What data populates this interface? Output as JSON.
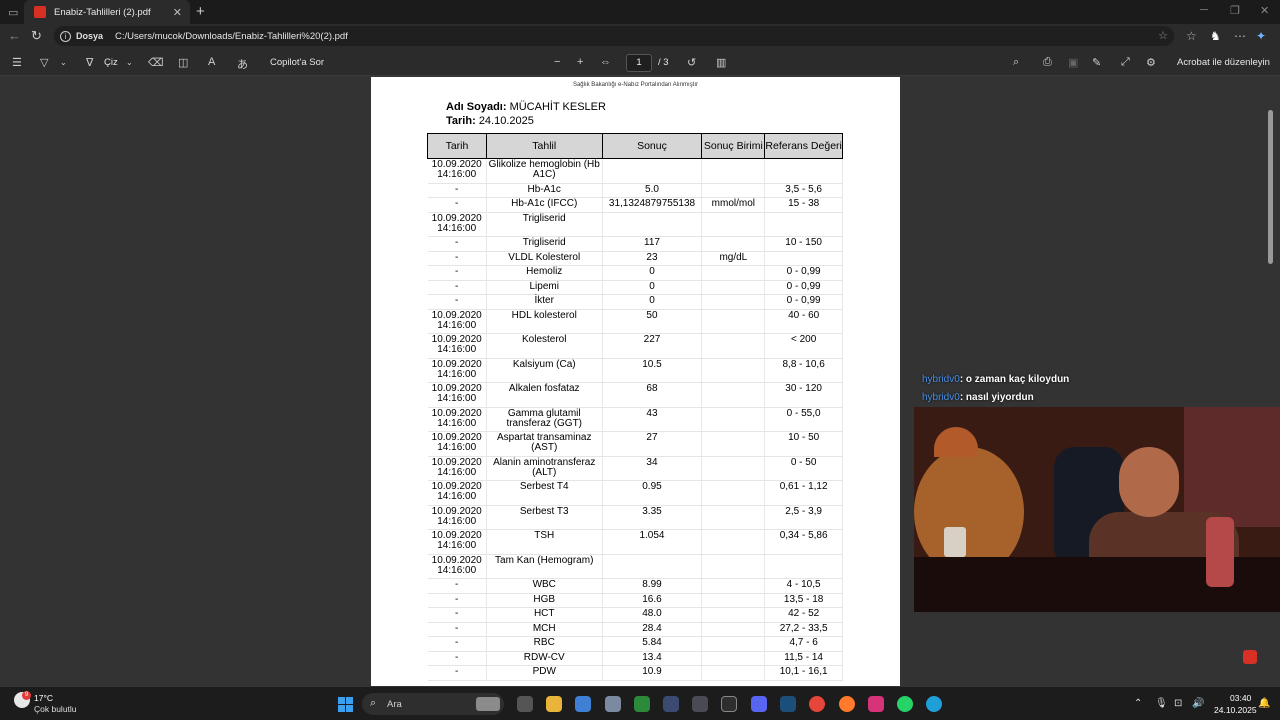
{
  "browser": {
    "tab_title": "Enabiz-Tahlilleri (2).pdf",
    "address_label": "Dosya",
    "url": "C:/Users/mucok/Downloads/Enabiz-Tahlilleri%20(2).pdf"
  },
  "pdf_toolbar": {
    "draw_label": "Çiz",
    "copilot_label": "Copilot'a Sor",
    "page_current": "1",
    "page_total": "/ 3",
    "acrobat_label": "Acrobat ile düzenleyin"
  },
  "document": {
    "header_note": "Sağlık Bakanlığı e-Nabız Portalından Alınmıştır",
    "name_label": "Adı Soyadı:",
    "name_value": "MÜCAHİT KESLER",
    "date_label": "Tarih:",
    "date_value": "24.10.2025",
    "columns": [
      "Tarih",
      "Tahlil",
      "Sonuç",
      "Sonuç Birimi",
      "Referans Değeri"
    ],
    "rows": [
      {
        "date": "10.09.2020 14:16:00",
        "test": "Glikolize hemoglobin (Hb A1C)",
        "result": "",
        "unit": "",
        "ref": "",
        "tall": true
      },
      {
        "date": "-",
        "test": "Hb-A1c",
        "result": "5.0",
        "unit": "",
        "ref": "3,5 - 5,6",
        "tall": false
      },
      {
        "date": "-",
        "test": "Hb-A1c (IFCC)",
        "result": "31,1324879755138",
        "unit": "mmol/mol",
        "ref": "15 - 38",
        "tall": false
      },
      {
        "date": "10.09.2020 14:16:00",
        "test": "Trigliserid",
        "result": "",
        "unit": "",
        "ref": "",
        "tall": true
      },
      {
        "date": "-",
        "test": "Trigliserid",
        "result": "117",
        "unit": "",
        "ref": "10 - 150",
        "tall": false
      },
      {
        "date": "-",
        "test": "VLDL Kolesterol",
        "result": "23",
        "unit": "mg/dL",
        "ref": "",
        "tall": false
      },
      {
        "date": "-",
        "test": "Hemoliz",
        "result": "0",
        "unit": "",
        "ref": "0 - 0,99",
        "tall": false
      },
      {
        "date": "-",
        "test": "Lipemi",
        "result": "0",
        "unit": "",
        "ref": "0 - 0,99",
        "tall": false
      },
      {
        "date": "-",
        "test": "İkter",
        "result": "0",
        "unit": "",
        "ref": "0 - 0,99",
        "tall": false
      },
      {
        "date": "10.09.2020 14:16:00",
        "test": "HDL kolesterol",
        "result": "50",
        "unit": "",
        "ref": "40 - 60",
        "tall": true
      },
      {
        "date": "10.09.2020 14:16:00",
        "test": "Kolesterol",
        "result": "227",
        "unit": "",
        "ref": "<    200",
        "tall": true
      },
      {
        "date": "10.09.2020 14:16:00",
        "test": "Kalsiyum (Ca)",
        "result": "10.5",
        "unit": "",
        "ref": "8,8 - 10,6",
        "tall": true
      },
      {
        "date": "10.09.2020 14:16:00",
        "test": "Alkalen fosfataz",
        "result": "68",
        "unit": "",
        "ref": "30 - 120",
        "tall": true
      },
      {
        "date": "10.09.2020 14:16:00",
        "test": "Gamma glutamil transferaz (GGT)",
        "result": "43",
        "unit": "",
        "ref": "0 - 55,0",
        "tall": true
      },
      {
        "date": "10.09.2020 14:16:00",
        "test": "Aspartat transaminaz (AST)",
        "result": "27",
        "unit": "",
        "ref": "10 - 50",
        "tall": true
      },
      {
        "date": "10.09.2020 14:16:00",
        "test": "Alanin aminotransferaz (ALT)",
        "result": "34",
        "unit": "",
        "ref": "0 - 50",
        "tall": true
      },
      {
        "date": "10.09.2020 14:16:00",
        "test": "Serbest T4",
        "result": "0.95",
        "unit": "",
        "ref": "0,61 - 1,12",
        "tall": true
      },
      {
        "date": "10.09.2020 14:16:00",
        "test": "Serbest T3",
        "result": "3.35",
        "unit": "",
        "ref": "2,5 - 3,9",
        "tall": true
      },
      {
        "date": "10.09.2020 14:16:00",
        "test": "TSH",
        "result": "1.054",
        "unit": "",
        "ref": "0,34 - 5,86",
        "tall": true
      },
      {
        "date": "10.09.2020 14:16:00",
        "test": "Tam Kan (Hemogram)",
        "result": "",
        "unit": "",
        "ref": "",
        "tall": true
      },
      {
        "date": "-",
        "test": "WBC",
        "result": "8.99",
        "unit": "",
        "ref": "4 - 10,5",
        "tall": false
      },
      {
        "date": "-",
        "test": "HGB",
        "result": "16.6",
        "unit": "",
        "ref": "13,5 - 18",
        "tall": false
      },
      {
        "date": "-",
        "test": "HCT",
        "result": "48.0",
        "unit": "",
        "ref": "42 - 52",
        "tall": false
      },
      {
        "date": "-",
        "test": "MCH",
        "result": "28.4",
        "unit": "",
        "ref": "27,2 - 33,5",
        "tall": false
      },
      {
        "date": "-",
        "test": "RBC",
        "result": "5.84",
        "unit": "",
        "ref": "4,7 - 6",
        "tall": false
      },
      {
        "date": "-",
        "test": "RDW-CV",
        "result": "13.4",
        "unit": "",
        "ref": "11,5 - 14",
        "tall": false
      },
      {
        "date": "-",
        "test": "PDW",
        "result": "10.9",
        "unit": "",
        "ref": "10,1 - 16,1",
        "tall": false
      }
    ]
  },
  "stream_chat": [
    {
      "user": "hybridv0",
      "message": ": o zaman kaç kiloydun"
    },
    {
      "user": "hybridv0",
      "message": ": nasıl yiyordun"
    }
  ],
  "taskbar": {
    "temperature": "17°C",
    "condition": "Çok bulutlu",
    "weather_badge": "9",
    "search_placeholder": "Ara",
    "time": "03:40",
    "date": "24.10.2025"
  }
}
